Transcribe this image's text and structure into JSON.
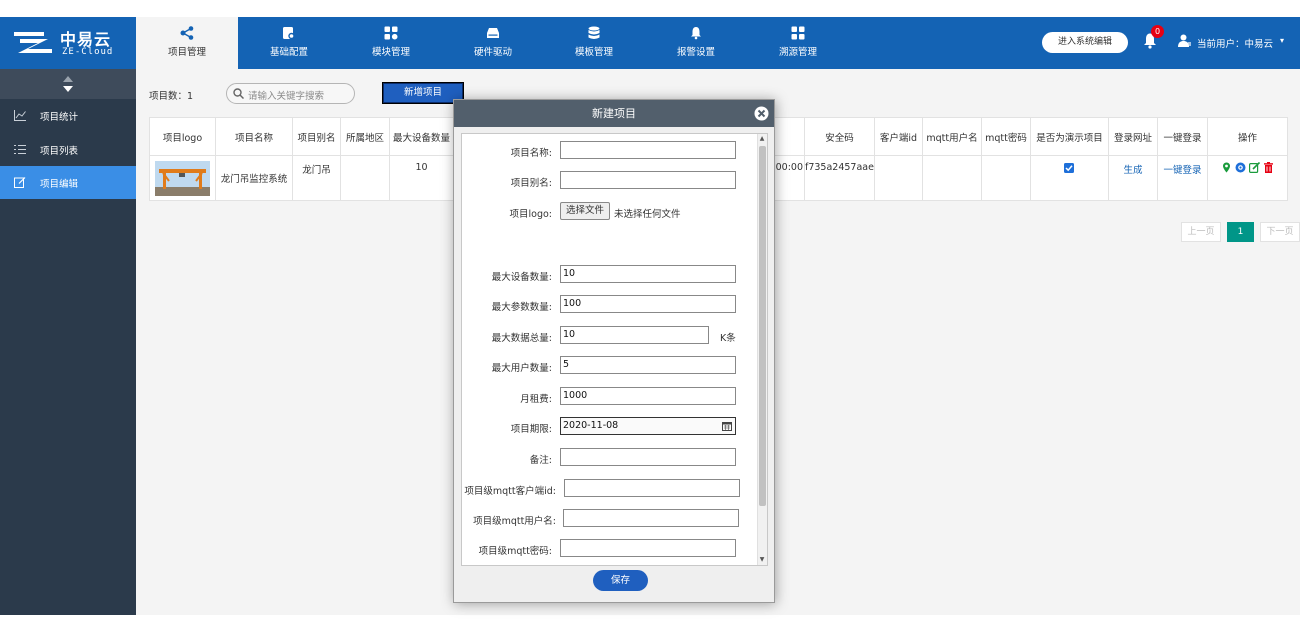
{
  "logo": {
    "cn": "中易云",
    "en": "ZE-Cloud"
  },
  "nav": {
    "tabs": [
      {
        "label": "项目管理",
        "icon": "share-nodes-icon",
        "active": true
      },
      {
        "label": "基础配置",
        "icon": "config-icon"
      },
      {
        "label": "模块管理",
        "icon": "modules-icon"
      },
      {
        "label": "硬件驱动",
        "icon": "hardware-icon"
      },
      {
        "label": "模板管理",
        "icon": "database-icon"
      },
      {
        "label": "报警设置",
        "icon": "bell-icon"
      },
      {
        "label": "溯源管理",
        "icon": "trace-icon"
      }
    ],
    "enter_system_label": "进入系统编辑",
    "notification_count": "0",
    "user_label": "当前用户：中易云",
    "user_caret": "▾"
  },
  "sidebar": {
    "items": [
      {
        "label": "项目统计",
        "icon": "chart-line-icon"
      },
      {
        "label": "项目列表",
        "icon": "list-icon"
      },
      {
        "label": "项目编辑",
        "icon": "edit-icon",
        "active": true
      }
    ]
  },
  "toolbar": {
    "count_label": "项目数：1",
    "search_placeholder": "请输入关键字搜索",
    "add_label": "新增项目"
  },
  "table": {
    "headers": {
      "logo": "项目logo",
      "name": "项目名称",
      "alias": "项目别名",
      "region": "所属地区",
      "max_dev": "最大设备数量",
      "time_partial": "",
      "key": "安全码",
      "client_id": "客户端id",
      "mqtt_user": "mqtt用户名",
      "mqtt_pwd": "mqtt密码",
      "is_demo": "是否为演示项目",
      "login_url": "登录网址",
      "one_click": "一键登录",
      "ops": "操作"
    },
    "rows": [
      {
        "name": "龙门吊监控系统",
        "alias": "龙门吊",
        "region": "",
        "max_dev": "10",
        "time_partial": "00:00",
        "key": "f735a2457aae",
        "client_id": "",
        "mqtt_user": "",
        "mqtt_pwd": "",
        "is_demo": true,
        "login_url": "生成",
        "one_click": "一键登录"
      }
    ]
  },
  "pager": {
    "prev": "上一页",
    "current": "1",
    "next": "下一页"
  },
  "dialog": {
    "title": "新建项目",
    "fields": {
      "name": {
        "label": "项目名称:",
        "value": ""
      },
      "alias": {
        "label": "项目别名:",
        "value": ""
      },
      "logo": {
        "label": "项目logo:",
        "button": "选择文件",
        "status": "未选择任何文件"
      },
      "max_devices": {
        "label": "最大设备数量:",
        "value": "10"
      },
      "max_params": {
        "label": "最大参数数量:",
        "value": "100"
      },
      "max_data": {
        "label": "最大数据总量:",
        "value": "10",
        "unit": "K条"
      },
      "max_users": {
        "label": "最大用户数量:",
        "value": "5"
      },
      "monthly_fee": {
        "label": "月租费:",
        "value": "1000"
      },
      "expiry": {
        "label": "项目期限:",
        "value": "2020-11-08"
      },
      "remark": {
        "label": "备注:",
        "value": ""
      },
      "mqtt_client_id": {
        "label": "项目级mqtt客户端id:",
        "value": ""
      },
      "mqtt_user": {
        "label": "项目级mqtt用户名:",
        "value": ""
      },
      "mqtt_pwd": {
        "label": "项目级mqtt密码:",
        "value": ""
      }
    },
    "save_label": "保存"
  },
  "colors": {
    "header": "#1463b4",
    "sidebar": "#2b3a4b",
    "sidebar_active": "#3a8ee6",
    "pager_active": "#009688",
    "badge": "#e60012"
  }
}
